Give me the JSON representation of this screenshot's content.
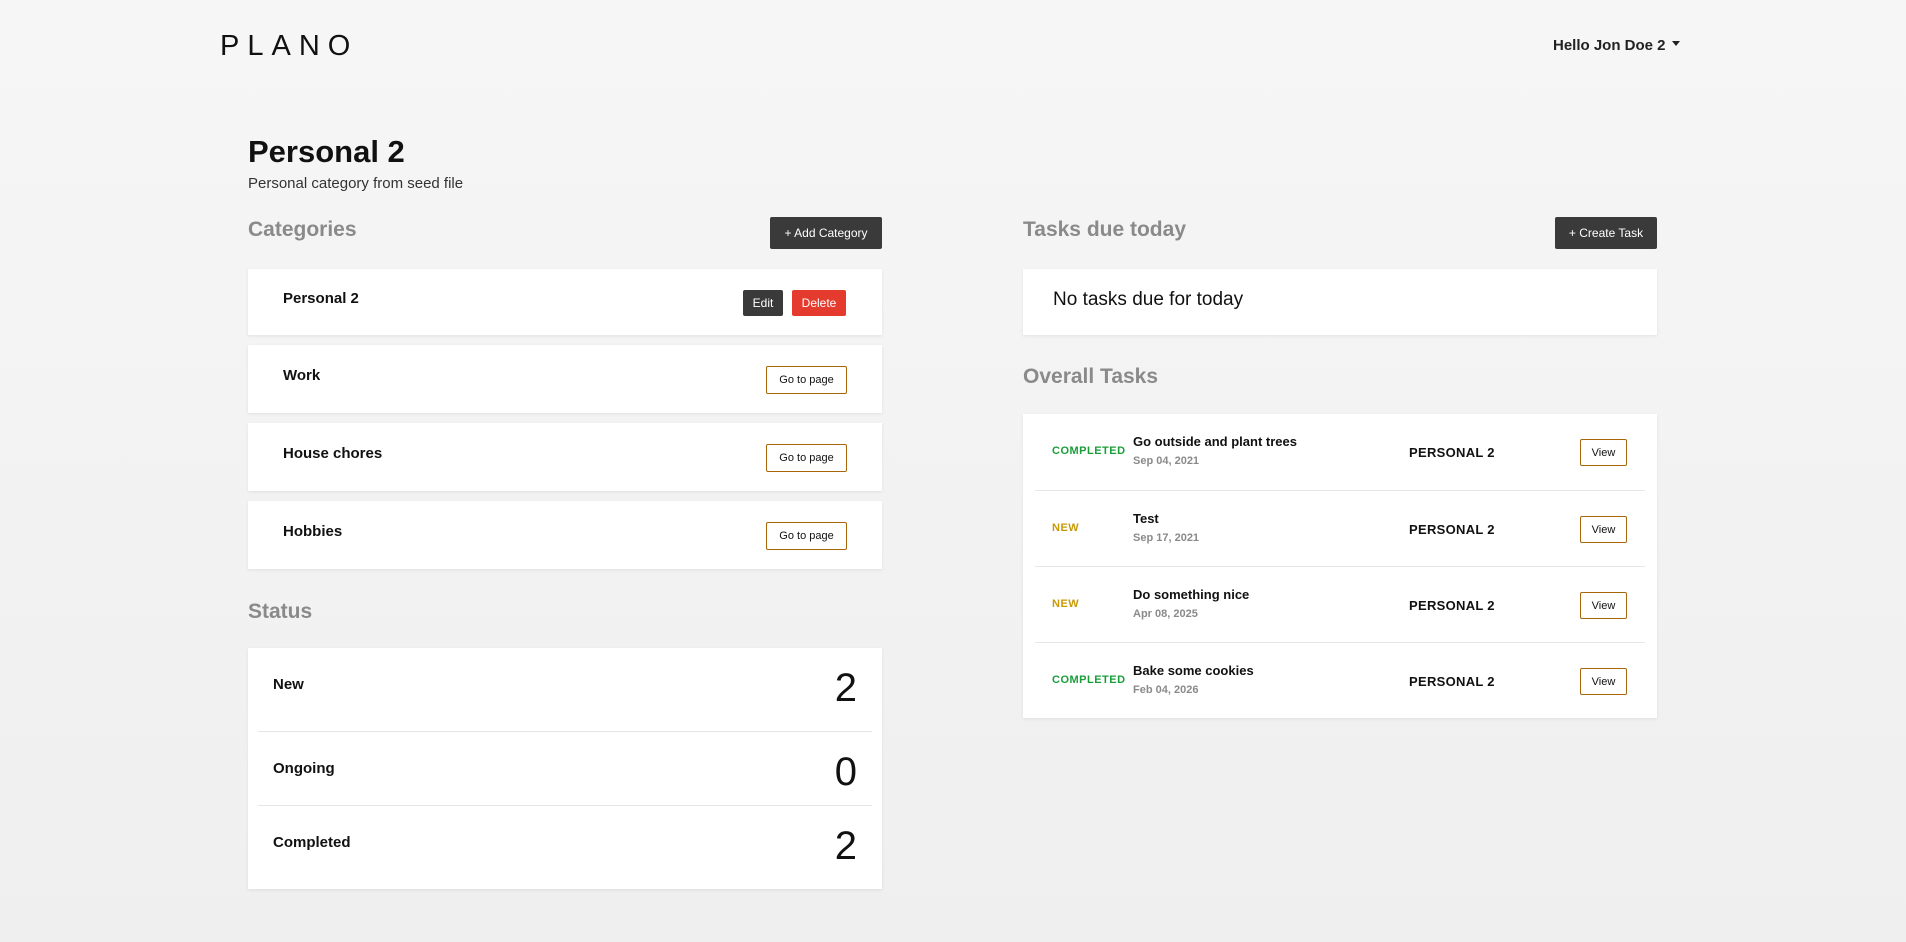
{
  "header": {
    "logo": "PLANO",
    "user_greeting": "Hello Jon Doe 2"
  },
  "page": {
    "title": "Personal 2",
    "subtitle": "Personal category from seed file"
  },
  "categories": {
    "heading": "Categories",
    "add_button": "+ Add Category",
    "items": [
      {
        "name": "Personal 2",
        "edit_label": "Edit",
        "delete_label": "Delete"
      },
      {
        "name": "Work",
        "action_label": "Go to page"
      },
      {
        "name": "House chores",
        "action_label": "Go to page"
      },
      {
        "name": "Hobbies",
        "action_label": "Go to page"
      }
    ]
  },
  "status": {
    "heading": "Status",
    "rows": [
      {
        "label": "New",
        "count": "2"
      },
      {
        "label": "Ongoing",
        "count": "0"
      },
      {
        "label": "Completed",
        "count": "2"
      }
    ]
  },
  "tasks_due": {
    "heading": "Tasks due today",
    "create_button": "+ Create Task",
    "empty_message": "No tasks due for today"
  },
  "overall_tasks": {
    "heading": "Overall Tasks",
    "view_label": "View",
    "rows": [
      {
        "status": "COMPLETED",
        "status_color": "#1a9e3a",
        "title": "Go outside and plant trees",
        "date": "Sep 04, 2021",
        "category": "PERSONAL 2"
      },
      {
        "status": "NEW",
        "status_color": "#c79a08",
        "title": "Test",
        "date": "Sep 17, 2021",
        "category": "PERSONAL 2"
      },
      {
        "status": "NEW",
        "status_color": "#c79a08",
        "title": "Do something nice",
        "date": "Apr 08, 2025",
        "category": "PERSONAL 2"
      },
      {
        "status": "COMPLETED",
        "status_color": "#1a9e3a",
        "title": "Bake some cookies",
        "date": "Feb 04, 2026",
        "category": "PERSONAL 2"
      }
    ]
  },
  "colors": {
    "accent_outline": "#a8660a",
    "danger": "#e53b2f",
    "dark_button": "#3a3a3a"
  }
}
